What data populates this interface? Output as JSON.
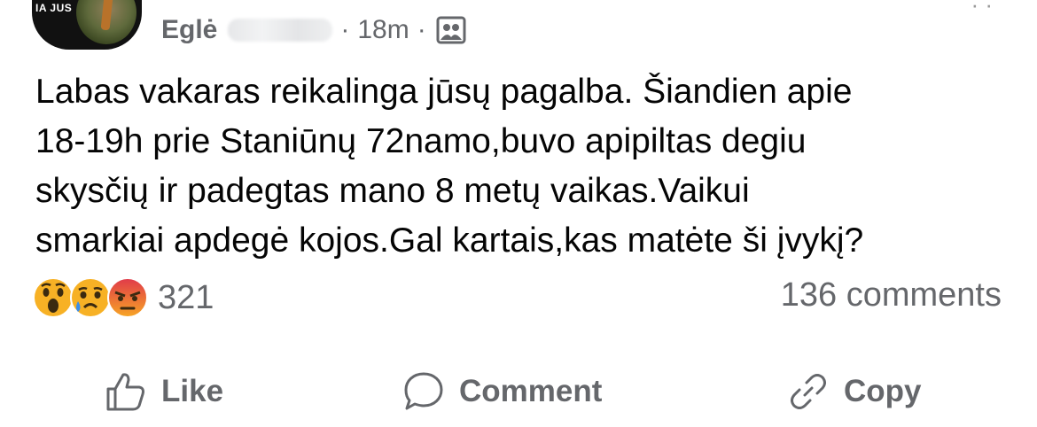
{
  "post": {
    "avatar_tag": "IA JUS",
    "author": "Eglė",
    "time": "18m",
    "separator": "·",
    "audience_icon": "group-audience-icon",
    "text_lines": [
      "Labas vakaras reikalinga jūsų pagalba. Šiandien apie",
      "18-19h prie Staniūnų 72namo,buvo apipiltas degiu",
      "skysčių ir padegtas mano 8 metų vaikas.Vaikui",
      "smarkiai apdegė kojos.Gal kartais,kas matėte ši įvykį?"
    ]
  },
  "reactions": {
    "icons": [
      "wow-reaction-icon",
      "sad-reaction-icon",
      "angry-reaction-icon"
    ],
    "count": "321",
    "comments": "136 comments"
  },
  "actions": {
    "like": "Like",
    "comment": "Comment",
    "copy": "Copy"
  },
  "colors": {
    "secondary_text": "#65676b",
    "primary_text": "#050505",
    "angry": "#e9710f",
    "wow_sad": "#f7b125"
  }
}
